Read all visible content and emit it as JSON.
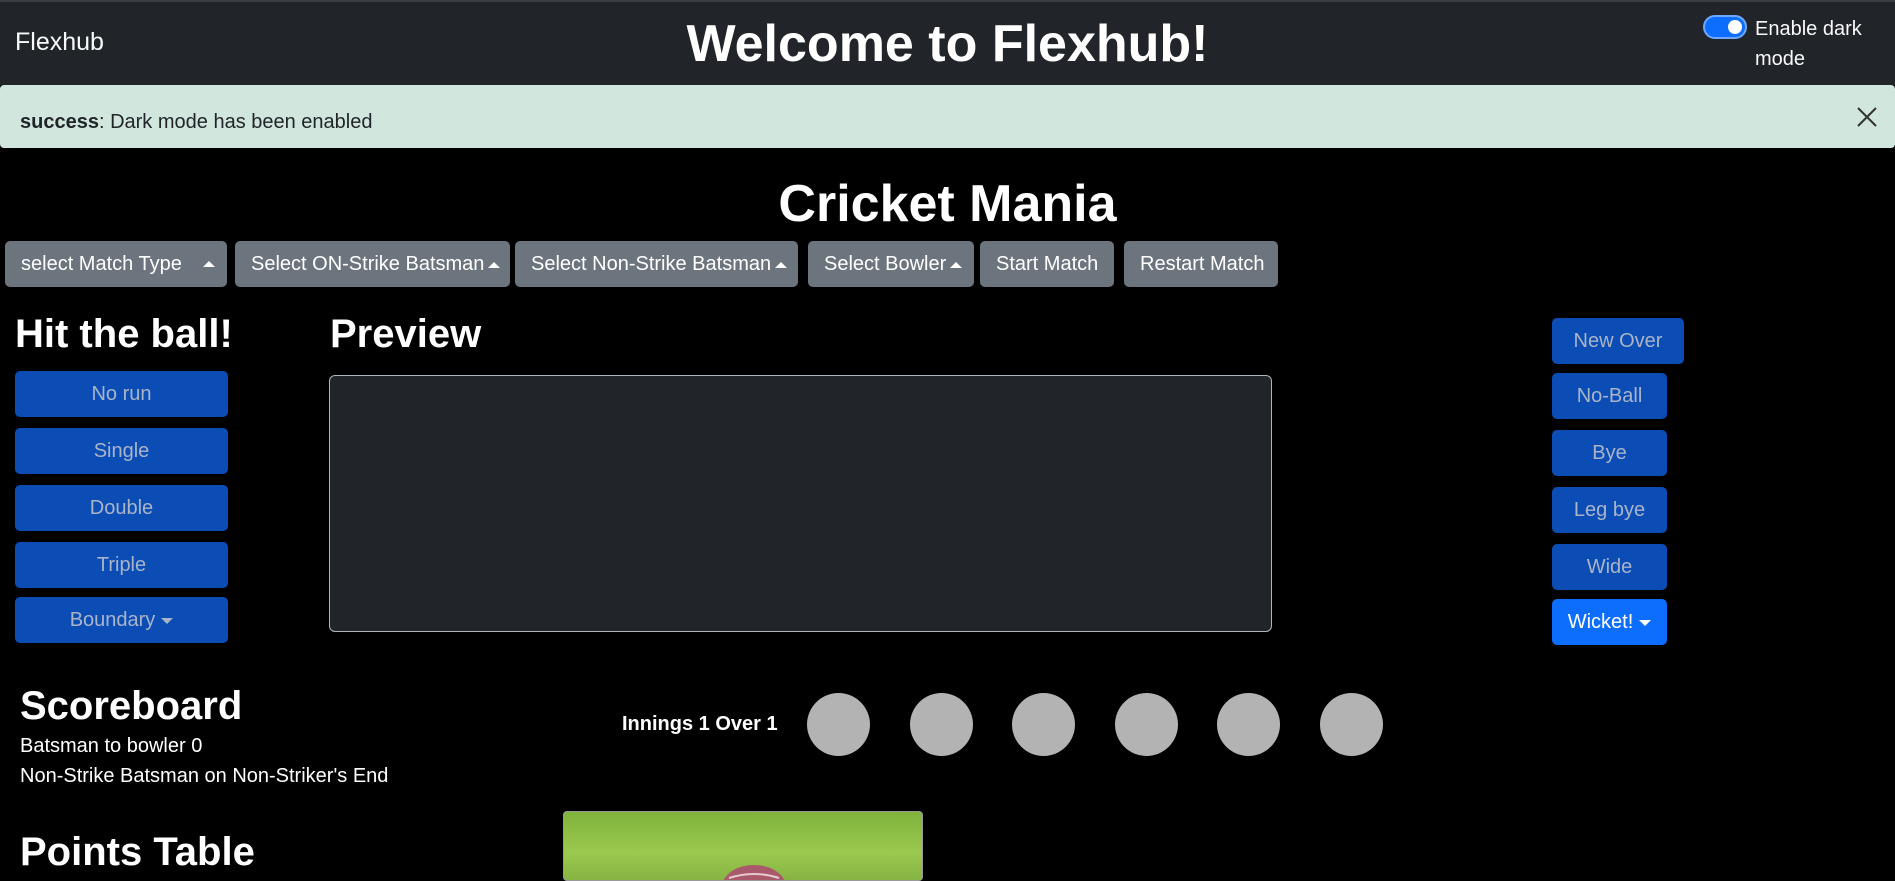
{
  "navbar": {
    "brand": "Flexhub",
    "title": "Welcome to Flexhub!",
    "dark_mode_label": "Enable dark mode",
    "dark_mode_enabled": true
  },
  "alert": {
    "type_label": "success",
    "message": ": Dark mode has been enabled",
    "close_icon": "close-icon"
  },
  "app_title": "Cricket Mania",
  "toolbar": {
    "match_type": "select Match Type",
    "on_strike": "Select ON-Strike Batsman",
    "non_strike": "Select Non-Strike Batsman",
    "bowler": "Select Bowler",
    "start": "Start Match",
    "restart": "Restart Match"
  },
  "hit": {
    "title": "Hit the ball!",
    "buttons": [
      "No run",
      "Single",
      "Double",
      "Triple",
      "Boundary"
    ]
  },
  "preview": {
    "title": "Preview",
    "value": ""
  },
  "extras": {
    "buttons": [
      "New Over",
      "No-Ball",
      "Bye",
      "Leg bye",
      "Wide",
      "Wicket!"
    ]
  },
  "scoreboard": {
    "title": "Scoreboard",
    "line1": "Batsman to bowler 0",
    "line2": "Non-Strike Batsman on Non-Striker's End",
    "over_label": "Innings 1 Over 1"
  },
  "points_table": {
    "title": "Points Table"
  },
  "colors": {
    "navbar_bg": "#212529",
    "alert_bg": "#d1e7dd",
    "primary_button": "#0d6efd",
    "muted_button": "#0b4db5",
    "secondary_button": "#6c757d",
    "ball_placeholder": "#b3b3b3"
  }
}
